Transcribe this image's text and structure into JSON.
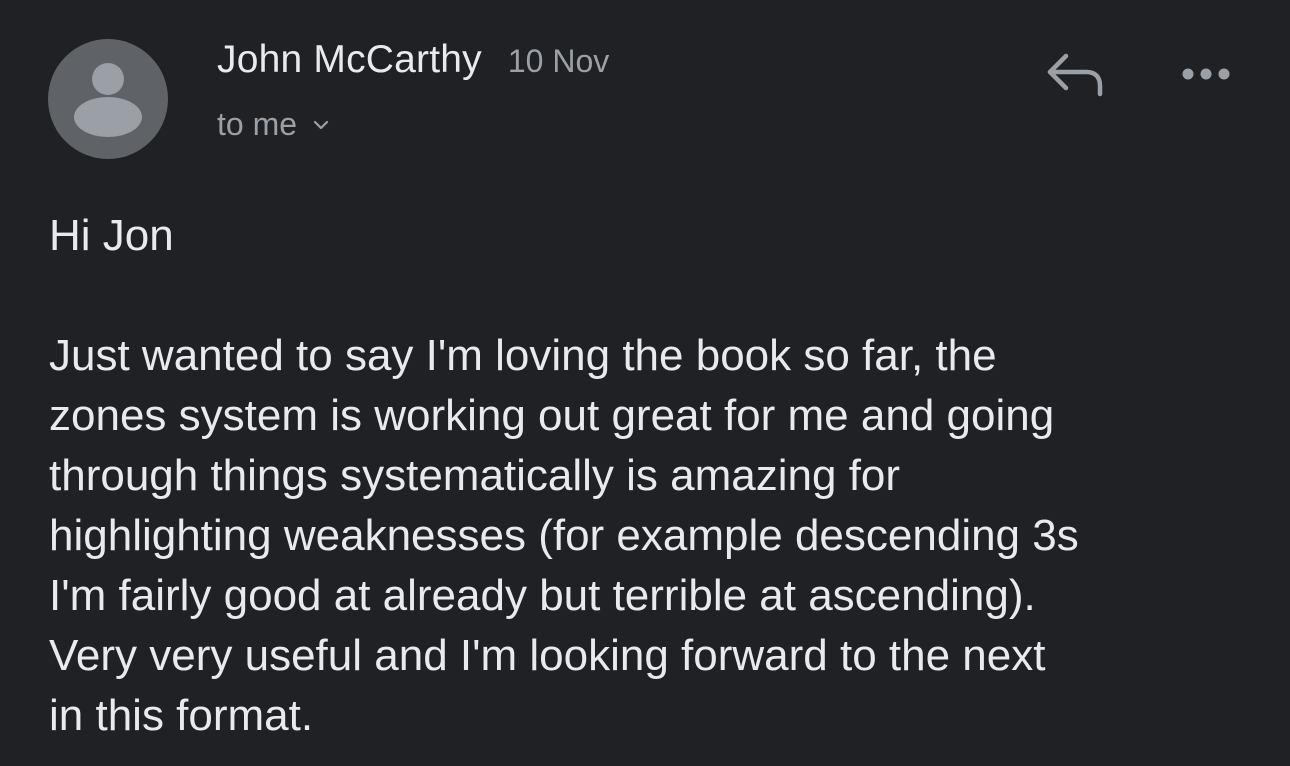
{
  "message": {
    "sender_name": "John McCarthy",
    "date": "10 Nov",
    "recipient": "to me",
    "greeting": "Hi Jon",
    "body_lines": [
      "Just wanted to say I'm loving the book so far, the",
      "zones system is working out great for me and going",
      "through things systematically is amazing for",
      "highlighting weaknesses (for example descending 3s",
      "I'm fairly good at already but terrible at ascending).",
      "Very very useful and I'm looking forward to the next",
      "in this format."
    ]
  },
  "icons": {
    "avatar": "person-avatar-icon",
    "recipient_toggle": "chevron-down-icon",
    "reply": "reply-icon",
    "more": "more-options-icon"
  },
  "colors": {
    "background": "#202124",
    "primary_text": "#e8eaed",
    "secondary_text": "#9aa0a6",
    "avatar_bg": "#5f6368",
    "avatar_fg": "#9aa0a6"
  }
}
